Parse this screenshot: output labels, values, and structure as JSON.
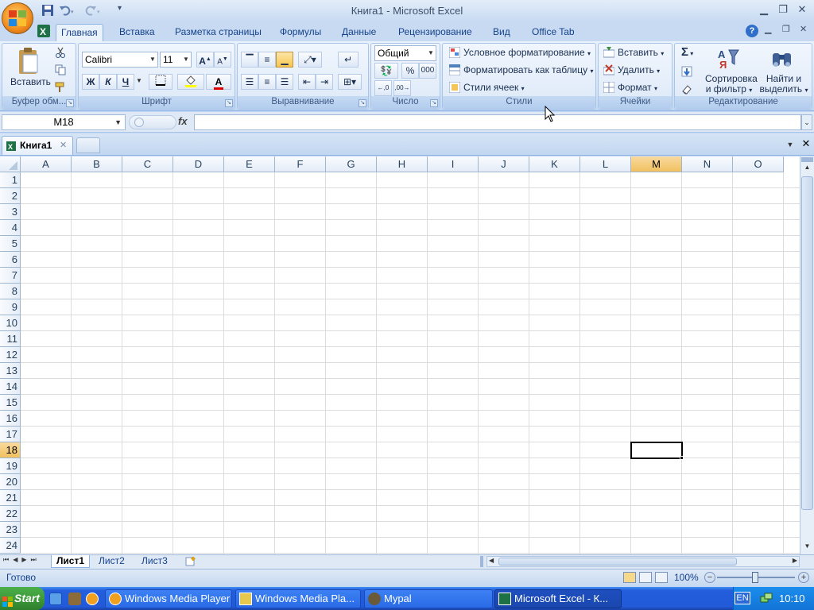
{
  "window": {
    "title": "Книга1 - Microsoft Excel"
  },
  "ribbon_tabs": [
    "Главная",
    "Вставка",
    "Разметка страницы",
    "Формулы",
    "Данные",
    "Рецензирование",
    "Вид",
    "Office Tab"
  ],
  "clipboard": {
    "paste_label": "Вставить",
    "group_label": "Буфер обм..."
  },
  "font": {
    "name": "Calibri",
    "size": "11",
    "bold": "Ж",
    "italic": "К",
    "underline": "Ч",
    "grow": "A",
    "shrink": "A",
    "color_glyph": "A",
    "group_label": "Шрифт"
  },
  "alignment": {
    "group_label": "Выравнивание"
  },
  "number": {
    "format": "Общий",
    "percent": "%",
    "thousands": "000",
    "group_label": "Число"
  },
  "styles": {
    "conditional": "Условное форматирование",
    "as_table": "Форматировать как таблицу",
    "cell_styles": "Стили ячеек",
    "group_label": "Стили"
  },
  "cells": {
    "insert": "Вставить",
    "delete": "Удалить",
    "format": "Формат",
    "group_label": "Ячейки"
  },
  "editing": {
    "sum": "Σ",
    "sort_l1": "Сортировка",
    "sort_l2": "и фильтр",
    "find_l1": "Найти и",
    "find_l2": "выделить",
    "group_label": "Редактирование"
  },
  "formula_bar": {
    "name_box": "M18",
    "fx": "fx",
    "value": ""
  },
  "workbook_tabs": [
    {
      "label": "Книга1"
    }
  ],
  "columns": [
    "A",
    "B",
    "C",
    "D",
    "E",
    "F",
    "G",
    "H",
    "I",
    "J",
    "K",
    "L",
    "M",
    "N",
    "O"
  ],
  "rows": [
    "1",
    "2",
    "3",
    "4",
    "5",
    "6",
    "7",
    "8",
    "9",
    "10",
    "11",
    "12",
    "13",
    "14",
    "15",
    "16",
    "17",
    "18",
    "19",
    "20",
    "21",
    "22",
    "23",
    "24"
  ],
  "active_cell": {
    "column": "M",
    "row": "18"
  },
  "sheets": [
    "Лист1",
    "Лист2",
    "Лист3"
  ],
  "status": {
    "ready": "Готово",
    "zoom": "100%"
  },
  "taskbar": {
    "start": "Start",
    "buttons": [
      "Windows Media Player",
      "Windows Media Pla...",
      "Mypal",
      "Microsoft Excel - К..."
    ],
    "lang": "EN",
    "time": "10:10"
  },
  "colors": {
    "ribbon": "#d4e4f7",
    "selected_header": "#f1c15f",
    "taskbar": "#245edc",
    "start": "#3c9a3a"
  }
}
